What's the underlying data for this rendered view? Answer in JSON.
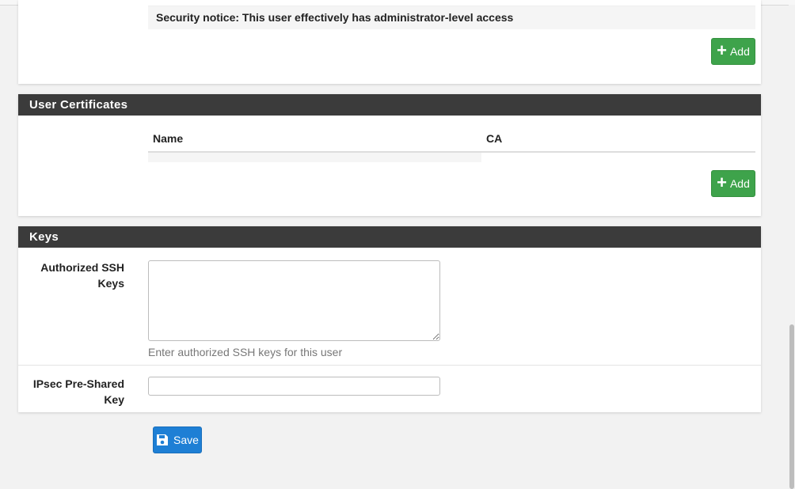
{
  "privileges": {
    "security_notice": "Security notice: This user effectively has administrator-level access",
    "add_label": "Add"
  },
  "certificates": {
    "title": "User Certificates",
    "columns": [
      "Name",
      "CA"
    ],
    "add_label": "Add"
  },
  "keys": {
    "title": "Keys",
    "ssh_label_line1": "Authorized SSH",
    "ssh_label_line2": "Keys",
    "ssh_value": "",
    "ssh_help": "Enter authorized SSH keys for this user",
    "psk_label_line1": "IPsec Pre-Shared",
    "psk_label_line2": "Key",
    "psk_value": ""
  },
  "save_label": "Save",
  "colors": {
    "heading_bg": "#3b3b3b",
    "add_button": "#3ea34b",
    "save_button": "#1e7fd5"
  }
}
